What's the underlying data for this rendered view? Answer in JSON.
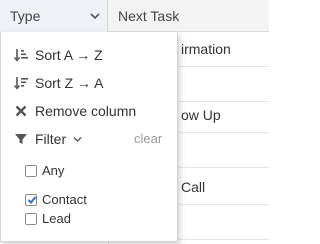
{
  "header": {
    "col_type_label": "Type",
    "col_next_label": "Next Task"
  },
  "rows": [
    {
      "next_task": "irmation"
    },
    {
      "next_task": ""
    },
    {
      "next_task": "ow Up"
    },
    {
      "next_task": ""
    },
    {
      "next_task": "Call"
    },
    {
      "next_task": ""
    }
  ],
  "menu": {
    "sort_asc": "Sort A → Z",
    "sort_desc": "Sort Z → A",
    "remove_column": "Remove column",
    "filter": "Filter",
    "clear": "clear",
    "options": [
      {
        "label": "Any",
        "checked": false
      },
      {
        "label": "Contact",
        "checked": true
      },
      {
        "label": "Lead",
        "checked": false
      }
    ]
  },
  "colors": {
    "icon": "#555555",
    "check_accent": "#2d6fd6",
    "muted": "#9a9a9a"
  }
}
